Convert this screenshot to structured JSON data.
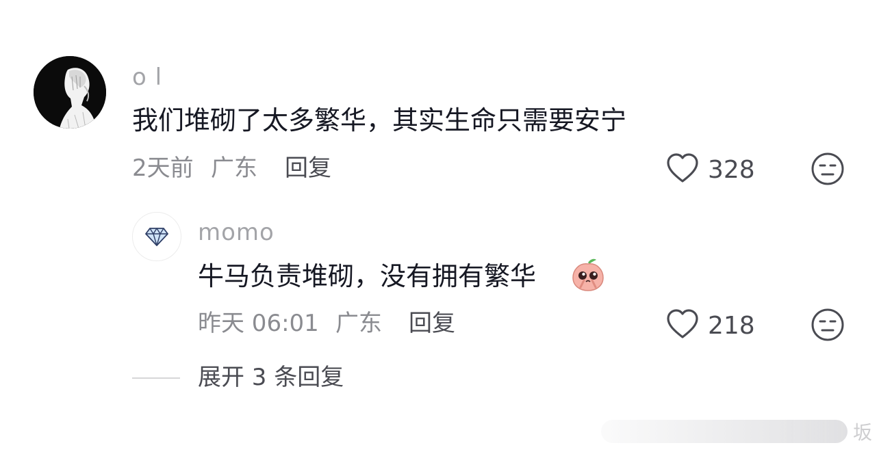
{
  "comment": {
    "username": "o l",
    "text": "我们堆砌了太多繁华，其实生命只需要安宁",
    "time": "2天前",
    "location": "广东",
    "reply_label": "回复",
    "like_count": "328",
    "icons": {
      "like": "heart-icon",
      "dislike": "meh-face-icon",
      "avatar": "sketch-portrait-avatar"
    }
  },
  "reply": {
    "username": "momo",
    "text": "牛马负责堆砌，没有拥有繁华",
    "emoji": "peach-pleading-emoji",
    "time": "昨天 06:01",
    "location": "广东",
    "reply_label": "回复",
    "like_count": "218",
    "icons": {
      "like": "heart-icon",
      "dislike": "meh-face-icon",
      "avatar": "diamond-icon"
    }
  },
  "expand": {
    "label": "展开 3 条回复"
  },
  "watermark": {
    "text": "坂"
  },
  "colors": {
    "text": "#161823",
    "muted": "#8a8b90",
    "username": "#a3a4a8",
    "icon": "#4a4b52"
  }
}
